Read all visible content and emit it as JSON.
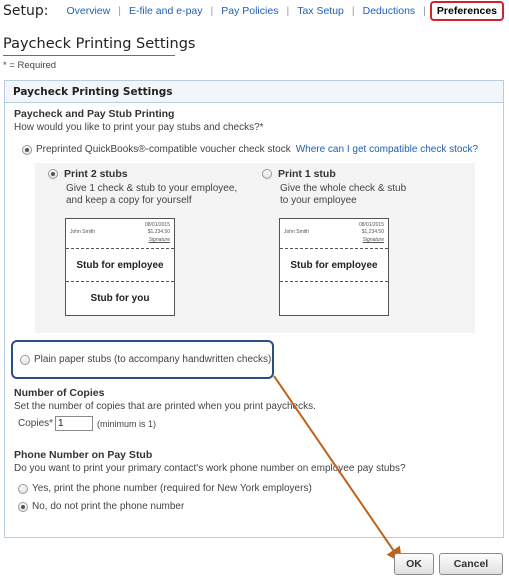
{
  "topnav": {
    "setup_label": "Setup:",
    "items": [
      "Overview",
      "E-file and e-pay",
      "Pay Policies",
      "Tax Setup",
      "Deductions",
      "Preferences"
    ],
    "active_item": "Preferences"
  },
  "page": {
    "title": "Paycheck Printing Settings",
    "required_note": "* = Required"
  },
  "panel": {
    "header": "Paycheck Printing Settings",
    "pay_stub": {
      "heading": "Paycheck and Pay Stub Printing",
      "question": "How would you like to print your pay stubs and checks?*",
      "preprinted_label": "Preprinted QuickBooks®-compatible voucher check stock",
      "preprinted_link": "Where can I get compatible check stock?",
      "print2": {
        "title": "Print 2 stubs",
        "desc_line1": "Give 1 check & stub to your employee,",
        "desc_line2": "and keep a copy for yourself"
      },
      "print1": {
        "title": "Print 1 stub",
        "desc_line1": "Give the whole check & stub",
        "desc_line2": "to your employee"
      },
      "diagram": {
        "date": "08/01/2015",
        "name": "John Smith",
        "amount": "$1,234.50",
        "signature": "Signature",
        "stub_employee": "Stub for employee",
        "stub_you": "Stub for you"
      },
      "plain_paper_label": "Plain paper stubs (to accompany handwritten checks)"
    },
    "copies": {
      "heading": "Number of Copies",
      "desc": "Set the number of copies that are printed when you print paychecks.",
      "label": "Copies*",
      "value": "1",
      "hint": "(minimum is 1)"
    },
    "phone": {
      "heading": "Phone Number on Pay Stub",
      "question": "Do you want to print your primary contact's work phone number on employee pay stubs?",
      "yes_label": "Yes, print the phone number (required for New York employers)",
      "no_label": "No, do not print the phone number"
    }
  },
  "buttons": {
    "ok": "OK",
    "cancel": "Cancel"
  },
  "colors": {
    "accent_link": "#1f5fb5",
    "highlight_red": "#d2232a",
    "highlight_blue": "#2c4e86",
    "arrow_orange": "#c0621a",
    "title_underline": "#4b8d2a"
  }
}
